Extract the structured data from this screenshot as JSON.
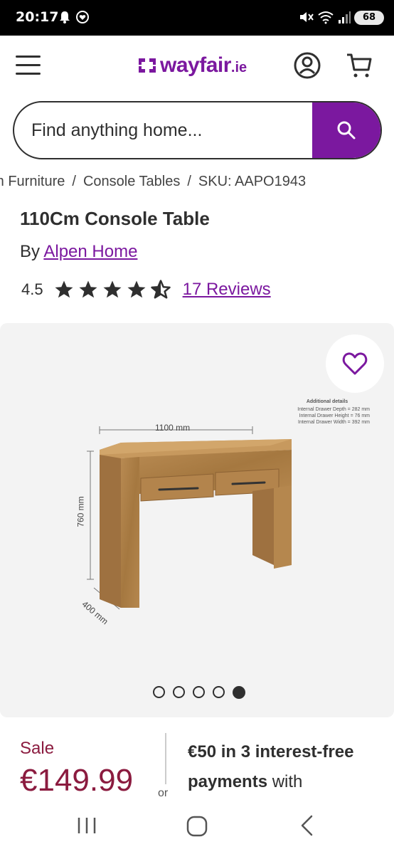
{
  "status_bar": {
    "time": "20:17",
    "battery": "68"
  },
  "header": {
    "brand": "wayfair",
    "tld": ".ie"
  },
  "search": {
    "placeholder": "Find anything home..."
  },
  "breadcrumb": {
    "items": [
      "om Furniture",
      "Console Tables",
      "SKU: AAPO1943"
    ],
    "separator": "/"
  },
  "product": {
    "title": "110Cm Console Table",
    "by_prefix": "By",
    "brand": "Alpen Home",
    "rating": "4.5",
    "stars": 4.5,
    "reviews": "17 Reviews"
  },
  "image": {
    "width_label": "1100 mm",
    "height_label": "760 mm",
    "depth_label": "400 mm",
    "details_heading": "Additional details",
    "details": [
      "Internal Drawer Depth = 282 mm",
      "Internal Drawer Height = 76 mm",
      "Internal Drawer Width = 392 mm"
    ],
    "dots_total": 5,
    "active_dot": 5
  },
  "pricing": {
    "sale_label": "Sale",
    "price": "€149.99",
    "or_label": "or",
    "installment_bold": "€50 in 3 interest-free payments",
    "installment_rest": " with"
  },
  "colors": {
    "brand": "#7b189f",
    "sale": "#8b1b3f",
    "text": "#2f2f2f"
  }
}
